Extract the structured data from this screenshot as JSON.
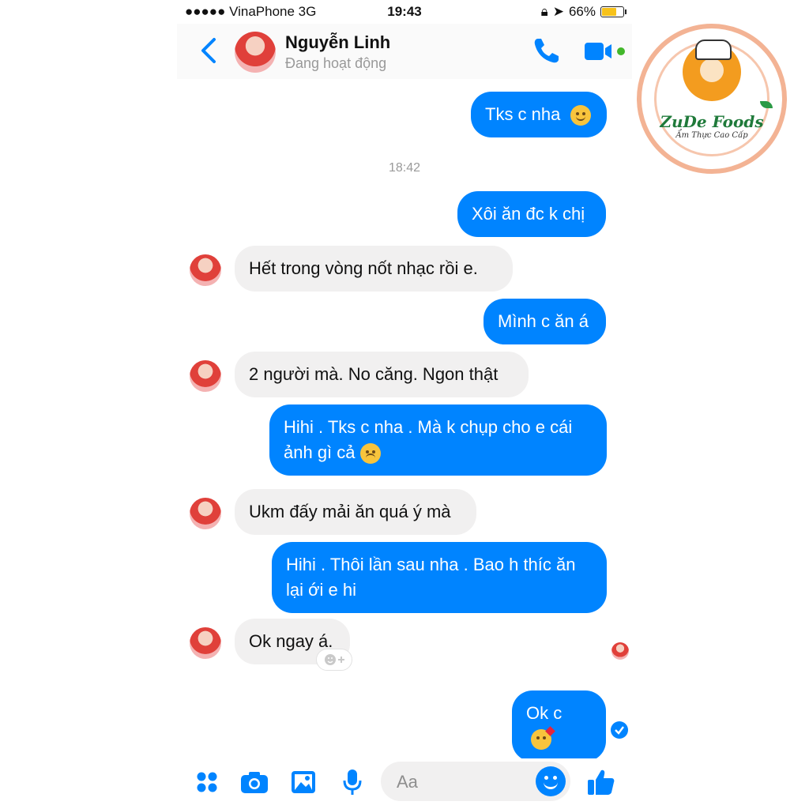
{
  "status_bar": {
    "carrier": "●●●●● VinaPhone   3G",
    "time": "19:43",
    "battery": "66%"
  },
  "header": {
    "name": "Nguyễn Linh",
    "status": "Đang hoạt động"
  },
  "colors": {
    "accent": "#0084ff",
    "incoming_bubble": "#f1f0f0"
  },
  "chat": {
    "timestamp": "18:42",
    "messages": [
      {
        "from": "me",
        "text": "Tks c nha",
        "emoji": "slightly-smiling-face"
      },
      {
        "from": "me",
        "text": "Xôi ăn đc k chị"
      },
      {
        "from": "them",
        "text": "Hết trong vòng nốt nhạc rồi e."
      },
      {
        "from": "me",
        "text": "Mình c ăn á"
      },
      {
        "from": "them",
        "text": "2 người mà. No căng. Ngon thật"
      },
      {
        "from": "me",
        "line1": "Hihi . Tks c nha . Mà k chụp cho e cái",
        "line2": "ảnh gì cả",
        "emoji": "unamused-face"
      },
      {
        "from": "them",
        "text": "Ukm đấy mải ăn quá ý mà"
      },
      {
        "from": "me",
        "line1": "Hihi . Thôi lần sau nha . Bao h thíc ăn",
        "line2": "lại ới e hi"
      },
      {
        "from": "them",
        "text": "Ok ngay á."
      },
      {
        "from": "me",
        "text": "Ok c",
        "emoji": "face-blowing-kiss"
      }
    ]
  },
  "composer": {
    "placeholder": "Aa"
  },
  "watermark": {
    "brand": "ZuDe Foods",
    "tagline": "Ẩm Thực Cao Cấp"
  }
}
